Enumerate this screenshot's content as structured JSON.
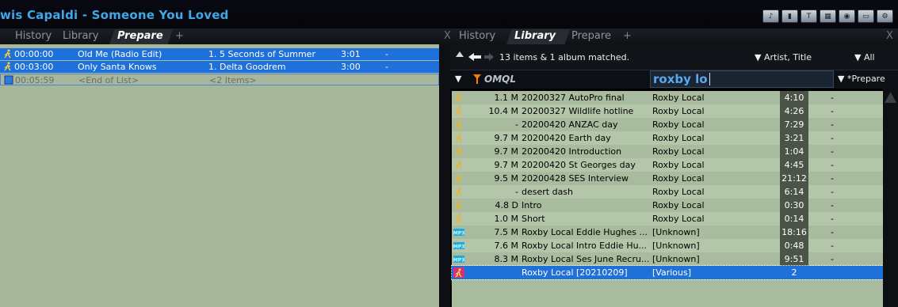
{
  "now_playing": "wis Capaldi - Someone You Loved",
  "top_icons": [
    "speaker-icon",
    "sign-icon",
    "text-icon",
    "grid-icon",
    "circle-icon",
    "monitor-icon",
    "settings-icon"
  ],
  "left_tabs": {
    "items": [
      "History",
      "Library",
      "Prepare"
    ],
    "active": "Prepare",
    "add": "+"
  },
  "right_tabs": {
    "close": "X",
    "items": [
      "History",
      "Library",
      "Prepare"
    ],
    "active": "Library",
    "add": "+",
    "close_right": "X"
  },
  "playlist": [
    {
      "time": "00:00:00",
      "title": "Old Me (Radio Edit)",
      "artist": "1. 5 Seconds of Summer",
      "duration": "3:01",
      "extra": "-",
      "selected": true
    },
    {
      "time": "00:03:00",
      "title": "Only Santa Knows",
      "artist": "1. Delta Goodrem",
      "duration": "3:00",
      "extra": "-",
      "selected": true
    },
    {
      "time": "00:05:59",
      "title": "<End of List>",
      "artist": "<2 Items>",
      "duration": "",
      "extra": "",
      "selected": false
    }
  ],
  "library": {
    "status": "13 items & 1 album matched.",
    "sort_label": "Artist, Title",
    "filter_label": "All",
    "query_type": "OMQL",
    "search_value": "roxby lo",
    "target_label": "*Prepare",
    "rows": [
      {
        "size": "1.1 M",
        "title": "20200327 AutoPro final",
        "artist": "Roxby Local",
        "duration": "4:10",
        "extra": "-",
        "icon": "audio"
      },
      {
        "size": "10.4 M",
        "title": "20200327 Wildlife hotline",
        "artist": "Roxby Local",
        "duration": "4:26",
        "extra": "-",
        "icon": "audio"
      },
      {
        "size": "-",
        "title": "20200420 ANZAC day",
        "artist": "Roxby Local",
        "duration": "7:29",
        "extra": "-",
        "icon": "audio"
      },
      {
        "size": "9.7 M",
        "title": "20200420 Earth day",
        "artist": "Roxby Local",
        "duration": "3:21",
        "extra": "-",
        "icon": "audio"
      },
      {
        "size": "9.7 M",
        "title": "20200420 Introduction",
        "artist": "Roxby Local",
        "duration": "1:04",
        "extra": "-",
        "icon": "audio"
      },
      {
        "size": "9.7 M",
        "title": "20200420 St Georges day",
        "artist": "Roxby Local",
        "duration": "4:45",
        "extra": "-",
        "icon": "audio"
      },
      {
        "size": "9.5 M",
        "title": "20200428 SES Interview",
        "artist": "Roxby Local",
        "duration": "21:12",
        "extra": "-",
        "icon": "audio"
      },
      {
        "size": "-",
        "title": "desert dash",
        "artist": "Roxby Local",
        "duration": "6:14",
        "extra": "-",
        "icon": "audio"
      },
      {
        "size": "4.8 D",
        "title": "Intro",
        "artist": "Roxby Local",
        "duration": "0:30",
        "extra": "-",
        "icon": "audio"
      },
      {
        "size": "1.0 M",
        "title": "Short",
        "artist": "Roxby Local",
        "duration": "0:14",
        "extra": "-",
        "icon": "audio"
      },
      {
        "size": "7.5 M",
        "title": "Roxby Local Eddie Hughes ...",
        "artist": "[Unknown]",
        "duration": "18:16",
        "extra": "-",
        "icon": "mp3"
      },
      {
        "size": "7.6 M",
        "title": "Roxby Local Intro Eddie Hu...",
        "artist": "[Unknown]",
        "duration": "0:48",
        "extra": "-",
        "icon": "mp3"
      },
      {
        "size": "8.3 M",
        "title": "Roxby Local Ses June Recru...",
        "artist": "[Unknown]",
        "duration": "9:51",
        "extra": "-",
        "icon": "mp3"
      },
      {
        "size": "",
        "title": "Roxby Local [20210209]",
        "artist": "[Various]",
        "duration": "2",
        "extra": "",
        "icon": "album",
        "selected": true
      }
    ]
  },
  "colors": {
    "selection": "#1e70da",
    "panel_bg": "#a6b79b",
    "title_text": "#3fa8e8",
    "search_text": "#5aa9f0",
    "omql": "#ff7a00"
  }
}
